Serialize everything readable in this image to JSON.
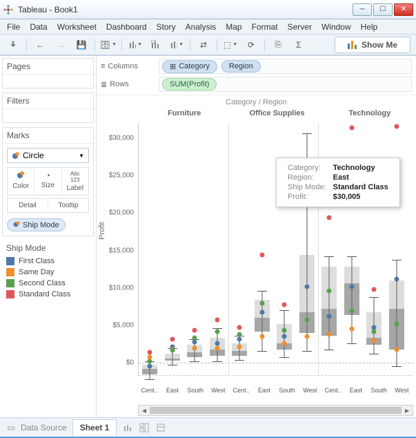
{
  "window": {
    "title": "Tableau - Book1"
  },
  "menu": {
    "file": "File",
    "data": "Data",
    "worksheet": "Worksheet",
    "dashboard": "Dashboard",
    "story": "Story",
    "analysis": "Analysis",
    "map": "Map",
    "format": "Format",
    "server": "Server",
    "window": "Window",
    "help": "Help"
  },
  "toolbar": {
    "showme": "Show Me"
  },
  "panels": {
    "pages": "Pages",
    "filters": "Filters",
    "marks": "Marks"
  },
  "marks": {
    "type": "Circle",
    "cells": {
      "color": "Color",
      "size": "Size",
      "label": "Label",
      "detail": "Detail",
      "tooltip": "Tooltip"
    },
    "field": "Ship Mode"
  },
  "legend": {
    "title": "Ship Mode",
    "items": [
      {
        "label": "First Class",
        "color": "#4e79a7"
      },
      {
        "label": "Same Day",
        "color": "#f28e2b"
      },
      {
        "label": "Second Class",
        "color": "#59a14f"
      },
      {
        "label": "Standard Class",
        "color": "#e15759"
      }
    ]
  },
  "shelves": {
    "columns_label": "Columns",
    "rows_label": "Rows",
    "columns": [
      "Category",
      "Region"
    ],
    "rows": [
      "SUM(Profit)"
    ]
  },
  "viz": {
    "title": "Category  /  Region",
    "ylabel": "Profit",
    "categories": [
      "Furniture",
      "Office Supplies",
      "Technology"
    ],
    "regions": [
      "Cent..",
      "East",
      "South",
      "West"
    ],
    "y_ticks": [
      "$0",
      "$5,000",
      "$10,000",
      "$15,000",
      "$20,000",
      "$25,000",
      "$30,000"
    ]
  },
  "tooltip": {
    "labels": {
      "category": "Category:",
      "region": "Region:",
      "shipmode": "Ship Mode:",
      "profit": "Profit:"
    },
    "values": {
      "category": "Technology",
      "region": "East",
      "shipmode": "Standard Class",
      "profit": "$30,005"
    }
  },
  "chart_data": {
    "type": "boxplot",
    "ylabel": "Profit",
    "ylim": [
      -3000,
      32000
    ],
    "facets": [
      "Furniture",
      "Office Supplies",
      "Technology"
    ],
    "x": [
      "Central",
      "East",
      "South",
      "West"
    ],
    "color_field": "Ship Mode",
    "color_levels": [
      "First Class",
      "Same Day",
      "Second Class",
      "Standard Class"
    ],
    "boxes": {
      "Furniture": {
        "Central": {
          "low": -2200,
          "q1": -1500,
          "med": -800,
          "q3": -200,
          "high": 200
        },
        "East": {
          "low": -200,
          "q1": 300,
          "med": 600,
          "q3": 1200,
          "high": 2000
        },
        "South": {
          "low": 200,
          "q1": 800,
          "med": 1400,
          "q3": 2400,
          "high": 3200
        },
        "West": {
          "low": 200,
          "q1": 1000,
          "med": 1800,
          "q3": 3400,
          "high": 4600
        }
      },
      "Office Supplies": {
        "Central": {
          "low": 400,
          "q1": 1000,
          "med": 1600,
          "q3": 2600,
          "high": 3600
        },
        "East": {
          "low": 1600,
          "q1": 4200,
          "med": 6000,
          "q3": 8400,
          "high": 9600
        },
        "South": {
          "low": 800,
          "q1": 1800,
          "med": 2600,
          "q3": 5200,
          "high": 7000
        },
        "West": {
          "low": 1600,
          "q1": 4000,
          "med": 6800,
          "q3": 14400,
          "high": 30600
        }
      },
      "Technology": {
        "Central": {
          "low": 1800,
          "q1": 3600,
          "med": 7200,
          "q3": 12800,
          "high": 14200
        },
        "East": {
          "low": 2600,
          "q1": 6400,
          "med": 10600,
          "q3": 12800,
          "high": 14200
        },
        "South": {
          "low": 1200,
          "q1": 2400,
          "med": 3400,
          "q3": 6800,
          "high": 8800
        },
        "West": {
          "low": -400,
          "q1": 1800,
          "med": 7200,
          "q3": 11000,
          "high": 13800
        }
      }
    },
    "points": {
      "Furniture": {
        "Central": [
          {
            "mode": "First Class",
            "y": -1800
          },
          {
            "mode": "Same Day",
            "y": -600
          },
          {
            "mode": "Second Class",
            "y": -1200
          },
          {
            "mode": "Standard Class",
            "y": 0
          }
        ],
        "East": [
          {
            "mode": "First Class",
            "y": 800
          },
          {
            "mode": "Same Day",
            "y": 400
          },
          {
            "mode": "Second Class",
            "y": 300
          },
          {
            "mode": "Standard Class",
            "y": 1800
          }
        ],
        "South": [
          {
            "mode": "First Class",
            "y": 1400
          },
          {
            "mode": "Same Day",
            "y": 600
          },
          {
            "mode": "Second Class",
            "y": 2000
          },
          {
            "mode": "Standard Class",
            "y": 3000
          }
        ],
        "West": [
          {
            "mode": "First Class",
            "y": 1200
          },
          {
            "mode": "Same Day",
            "y": 600
          },
          {
            "mode": "Second Class",
            "y": 2800
          },
          {
            "mode": "Standard Class",
            "y": 4400
          }
        ]
      },
      "Office Supplies": {
        "Central": [
          {
            "mode": "First Class",
            "y": 1800
          },
          {
            "mode": "Same Day",
            "y": 800
          },
          {
            "mode": "Second Class",
            "y": 2400
          },
          {
            "mode": "Standard Class",
            "y": 3400
          }
        ],
        "East": [
          {
            "mode": "First Class",
            "y": 5400
          },
          {
            "mode": "Same Day",
            "y": 2200
          },
          {
            "mode": "Second Class",
            "y": 6600
          },
          {
            "mode": "Standard Class",
            "y": 13000
          }
        ],
        "South": [
          {
            "mode": "First Class",
            "y": 2200
          },
          {
            "mode": "Same Day",
            "y": 1200
          },
          {
            "mode": "Second Class",
            "y": 3000
          },
          {
            "mode": "Standard Class",
            "y": 6400
          }
        ],
        "West": [
          {
            "mode": "First Class",
            "y": 8800
          },
          {
            "mode": "Same Day",
            "y": 2200
          },
          {
            "mode": "Second Class",
            "y": 4400
          },
          {
            "mode": "Standard Class",
            "y": 25600
          }
        ]
      },
      "Technology": {
        "Central": [
          {
            "mode": "First Class",
            "y": 4800
          },
          {
            "mode": "Same Day",
            "y": 2400
          },
          {
            "mode": "Second Class",
            "y": 8200
          },
          {
            "mode": "Standard Class",
            "y": 18000
          }
        ],
        "East": [
          {
            "mode": "First Class",
            "y": 8800
          },
          {
            "mode": "Same Day",
            "y": 3200
          },
          {
            "mode": "Second Class",
            "y": 5600
          },
          {
            "mode": "Standard Class",
            "y": 30005
          }
        ],
        "South": [
          {
            "mode": "First Class",
            "y": 3400
          },
          {
            "mode": "Same Day",
            "y": 1600
          },
          {
            "mode": "Second Class",
            "y": 2800
          },
          {
            "mode": "Standard Class",
            "y": 8400
          }
        ],
        "West": [
          {
            "mode": "First Class",
            "y": 9800
          },
          {
            "mode": "Same Day",
            "y": 400
          },
          {
            "mode": "Second Class",
            "y": 3800
          },
          {
            "mode": "Standard Class",
            "y": 30200
          }
        ]
      }
    }
  },
  "footer": {
    "datasource": "Data Source",
    "sheet": "Sheet 1"
  }
}
